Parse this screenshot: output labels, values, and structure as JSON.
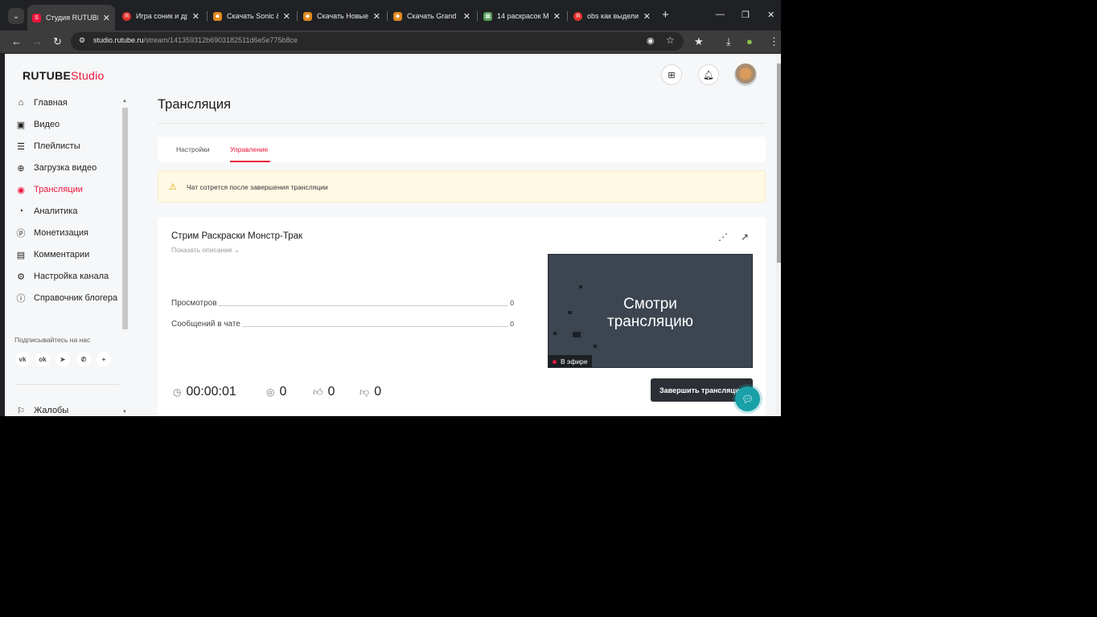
{
  "browser": {
    "tabs": [
      {
        "title": "Студия RUTUBE",
        "favicon": "rutube-studio-icon",
        "active": true
      },
      {
        "title": "Игра соник и др",
        "favicon": "yandex-icon"
      },
      {
        "title": "Скачать Sonic &",
        "favicon": "download-site-icon"
      },
      {
        "title": "Скачать Новые",
        "favicon": "download-site-icon"
      },
      {
        "title": "Скачать Grand T",
        "favicon": "download-site-icon"
      },
      {
        "title": "14 раскрасок М",
        "favicon": "image-site-icon"
      },
      {
        "title": "obs как выдели",
        "favicon": "yandex-icon"
      }
    ],
    "url_host": "studio.rutube.ru",
    "url_path": "/stream/141359312b6903182511d6e5e775b8ce"
  },
  "header": {
    "logo_main": "RUTUBE",
    "logo_sub": "Studio",
    "brand_color": "#ed143b"
  },
  "sidebar": {
    "items": [
      {
        "label": "Главная",
        "icon": "home-icon"
      },
      {
        "label": "Видео",
        "icon": "video-icon"
      },
      {
        "label": "Плейлисты",
        "icon": "playlist-icon"
      },
      {
        "label": "Загрузка видео",
        "icon": "upload-icon"
      },
      {
        "label": "Трансляции",
        "icon": "broadcast-icon",
        "active": true
      },
      {
        "label": "Аналитика",
        "icon": "analytics-icon"
      },
      {
        "label": "Монетизация",
        "icon": "monetization-icon"
      },
      {
        "label": "Комментарии",
        "icon": "comments-icon"
      },
      {
        "label": "Настройка канала",
        "icon": "settings-icon"
      },
      {
        "label": "Справочник блогера",
        "icon": "info-icon"
      }
    ],
    "subscribe_title": "Подписывайтесь на нас",
    "socials": [
      "vk-icon",
      "ok-icon",
      "telegram-icon",
      "viber-icon",
      "more-icon"
    ],
    "bottom_item": {
      "label": "Жалобы",
      "icon": "flag-icon"
    }
  },
  "main": {
    "title": "Трансляция",
    "tabs": [
      {
        "label": "Настройки"
      },
      {
        "label": "Управление",
        "active": true
      }
    ],
    "alert_text": "Чат сотрется после завершения трансляции",
    "stream": {
      "title": "Стрим Раскраски Монстр-Трак",
      "show_description": "Показать описание",
      "stats": [
        {
          "label": "Просмотров",
          "value": "0"
        },
        {
          "label": "Сообщений в чате",
          "value": "0"
        }
      ],
      "player_text_line1": "Смотри",
      "player_text_line2": "трансляцию",
      "live_badge": "В эфире",
      "timer": "00:00:01",
      "viewers": "0",
      "likes": "0",
      "dislikes": "0",
      "end_button": "Завершить трансляцию"
    }
  }
}
